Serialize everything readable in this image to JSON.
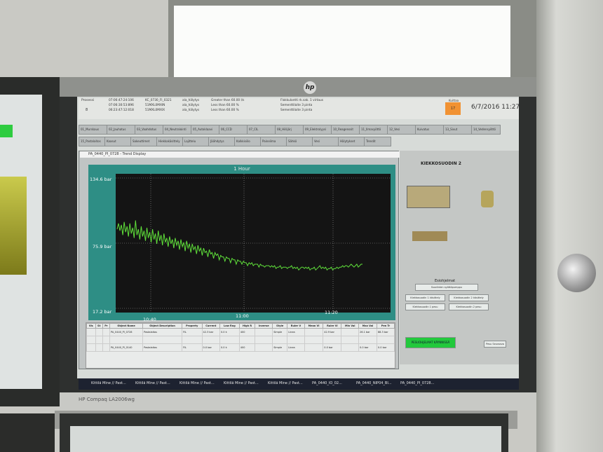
{
  "screen_header": {
    "header_label": "Prosessi",
    "header_num": "8",
    "alarm_rows": [
      {
        "time": "07:06:47:24:106",
        "tag": "KC_0730_FI_0321",
        "group": "ala_hälytys",
        "text": "Greater than 60.00 l/s",
        "desc": "Flokkulantti rk.sak. 1 virtaus"
      },
      {
        "time": "07:06:30:53:896",
        "tag": "51MXL0MXIN",
        "group": "ala_hälytys",
        "text": "Less than 60.00 %",
        "desc": "Sementtilaite 3 pinta"
      },
      {
        "time": "06:23:47:12:018",
        "tag": "51MXL0MXIX",
        "group": "ala_hälytys",
        "text": "Less than 60.00 %",
        "desc": "Sementtilaite 3 pinta"
      }
    ],
    "alarm_badge_label": "Kuittaa",
    "alarm_badge_code": "17",
    "datetime": "6/7/2016 11:27"
  },
  "tabs": [
    "01_Murskaus",
    "02_Jauhatus",
    "03_Vaahdotus",
    "04_Neutralointi",
    "05_Autoklaavi",
    "06_CCD",
    "07_CIL",
    "08_Hiilijärj",
    "09_Elektrolyysi",
    "10_Reagenssit",
    "11_Ilmasyöttö",
    "12_Vesi",
    "Kuivatus",
    "13_Sivut",
    "14_Vedensyöttö",
    "15_Pastalaitos",
    "Kaasut",
    "Sakeuttimet",
    "Hiekkakäsittely",
    "Lajittelu",
    "Jäähdytys",
    "Kalkkisiilo",
    "Paineilma",
    "Sähkö",
    "Vesi",
    "Hälytykset",
    "Trendit"
  ],
  "trend": {
    "window_title": "PA_0440_PI_0728 - Trend Display",
    "header": "1 Hour",
    "y_labels": [
      "134.6 bar",
      "75.9 bar",
      "17.2 bar"
    ],
    "x_labels": [
      "10:40",
      "11:00",
      "11:20"
    ],
    "line_color": "#5fe03a",
    "series": [
      62,
      66,
      61,
      65,
      58,
      67,
      60,
      64,
      57,
      66,
      59,
      63,
      56,
      68,
      58,
      62,
      55,
      64,
      57,
      61,
      54,
      63,
      56,
      60,
      53,
      62,
      55,
      59,
      52,
      61,
      54,
      58,
      51,
      59,
      53,
      56,
      50,
      57,
      52,
      55,
      49,
      56,
      51,
      54,
      48,
      55,
      50,
      53,
      47,
      54,
      49,
      52,
      46,
      52,
      48,
      50,
      45,
      51,
      47,
      49,
      44,
      49,
      46,
      47,
      43,
      48,
      45,
      46,
      42,
      46,
      44,
      45,
      41,
      44,
      43,
      43,
      40,
      43,
      42,
      42,
      39,
      42,
      41,
      41,
      38,
      41,
      40,
      40,
      38,
      40,
      39,
      39,
      37,
      39,
      38,
      39,
      37,
      38,
      38,
      38,
      36,
      38,
      37,
      37,
      36,
      37,
      37,
      37,
      36,
      37,
      36,
      37,
      35,
      36,
      36,
      37,
      35,
      36,
      36,
      36,
      35,
      36,
      36,
      37,
      35,
      36,
      35,
      36,
      34,
      35,
      36,
      36,
      35,
      36,
      35,
      36,
      34,
      35,
      35,
      36,
      34,
      35,
      36,
      37,
      35,
      36,
      35,
      36,
      34,
      35,
      35,
      36,
      34,
      35,
      35,
      36,
      35,
      36,
      36,
      37,
      36,
      37,
      37,
      36,
      37,
      38,
      37,
      36,
      37,
      38,
      36,
      37,
      38,
      38
    ],
    "table_headers": [
      "Vis",
      "St",
      "Pr",
      "Object Name",
      "Object Description",
      "Property",
      "Current",
      "Low Rng",
      "High R",
      "Inverse",
      "Style",
      "Ruler V",
      "Mean Vl",
      "Ruler Vi",
      "Min Val",
      "Max Val",
      "Pen Tr"
    ],
    "table_rows": [
      [
        "",
        "",
        "",
        "PA_0440_PI_0728",
        "Pastalaitos",
        "FIL",
        "42.3 bar",
        "0.0 k",
        "400",
        "",
        "Simple",
        "Linea",
        "",
        "42.9 bar",
        "",
        "26.1 bar",
        "88.3 bar"
      ],
      [
        "",
        "",
        "",
        "",
        "",
        "",
        "",
        "",
        "",
        "",
        "",
        "",
        "",
        "",
        "",
        "",
        ""
      ],
      [
        "",
        "",
        "",
        "PA_0440_PI_0140",
        "Pastalaitos",
        "FIL",
        "0.0 bar",
        "0.0 k",
        "400",
        "",
        "Simple",
        "Linea",
        "",
        "0.0 bar",
        "",
        "0.0 bar",
        "0.0 bar"
      ]
    ]
  },
  "process": {
    "title": "KIEKKOSUODIN 2",
    "section_title": "Esiohjelmat",
    "buttons": [
      "Suodinten syöttöpumppu",
      "Kiekkosuodin 1 käsittely",
      "Kiekkosuodin 2 käsittely",
      "Kiekkosuodin 1 pesu",
      "Kiekkosuodin 2 pesu"
    ],
    "ready_button": "PESUOHJELMAT KÄYNNISSÄ",
    "next_button": "Pesu Seuraava"
  },
  "taskbar": [
    "Kittilä Mine // Past...",
    "Kittilä Mine // Past...",
    "Kittilä Mine // Past...",
    "Kittilä Mine // Past...",
    "Kittilä Mine // Past...",
    "PA_0440_IO_02...",
    "PA_0440_NIP04_BI...",
    "PA_0440_PI_0728..."
  ],
  "brand_label": "HP Compaq LA2006wg",
  "hp_logo": "hp"
}
